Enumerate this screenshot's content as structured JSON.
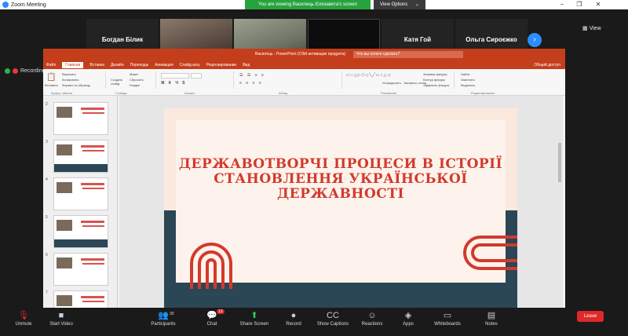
{
  "titlebar": {
    "app_name": "Zoom Meeting",
    "minimize": "−",
    "restore": "❐",
    "close": "✕"
  },
  "banner": {
    "viewing": "You are viewing Василець Єлизавета's screen",
    "view_options": "View Options"
  },
  "gallery": {
    "participants": [
      {
        "big": "Богдан Білик",
        "name": "Богдан Білик",
        "muted": true,
        "kind": "name"
      },
      {
        "big": "",
        "name": "Мірошниченко Вален...",
        "muted": true,
        "kind": "video1"
      },
      {
        "big": "",
        "name": "Оксана Васюк",
        "muted": false,
        "kind": "video2"
      },
      {
        "big": "",
        "name": "Василець Єлизавета",
        "muted": false,
        "kind": "dark"
      },
      {
        "big": "Катя Гой",
        "name": "Катя Гой",
        "muted": true,
        "kind": "name"
      },
      {
        "big": "Ольга Сироєжко",
        "name": "Ольга Сироєжко",
        "muted": true,
        "kind": "name"
      }
    ],
    "view_label": "View"
  },
  "recording": {
    "label": "Recording"
  },
  "powerpoint": {
    "window_title": "Василець - PowerPoint (Сбій активации продукта)",
    "search_placeholder": "Что вы хотите сделать?",
    "tabs": [
      "Файл",
      "Главная",
      "Вставка",
      "Дизайн",
      "Переходы",
      "Анимация",
      "Слайд-шоу",
      "Рецензирование",
      "Вид"
    ],
    "active_tab": "Главная",
    "share": "Общий доступ",
    "ribbon_groups": [
      "Буфер обмена",
      "Слайды",
      "Шрифт",
      "Абзац",
      "Рисование",
      "Редактирование"
    ],
    "ribbon_buttons": {
      "paste": "Вставить",
      "cut": "Вырезать",
      "copy": "Копировать",
      "format_painter": "Формат по образцу",
      "new_slide": "Создать слайд",
      "layout": "Макет",
      "reset": "Сбросить",
      "section": "Раздел",
      "arrange": "Упорядочить",
      "quick_styles": "Экспресс-стили",
      "shape_fill": "Заливка фигуры",
      "shape_outline": "Контур фигуры",
      "shape_effects": "Эффекты фигуры",
      "find": "Найти",
      "replace": "Заменить",
      "select": "Выделить"
    },
    "thumb_numbers": [
      "2",
      "3",
      "4",
      "5",
      "6",
      "7"
    ],
    "slide_title": "ДЕРЖАВОТВОРЧІ ПРОЦЕСИ В ІСТОРІЇ СТАНОВЛЕННЯ УКРАЇНСЬКОЇ ДЕРЖАВНОСТІ"
  },
  "toolbar": {
    "unmute": "Unmute",
    "start_video": "Start Video",
    "participants": "Participants",
    "participants_count": "30",
    "chat": "Chat",
    "chat_badge": "13",
    "share_screen": "Share Screen",
    "record": "Record",
    "show_captions": "Show Captions",
    "reactions": "Reactions",
    "apps": "Apps",
    "whiteboards": "Whiteboards",
    "notes": "Notes",
    "leave": "Leave"
  },
  "colors": {
    "zoom_blue": "#2d8cff",
    "ppt_red": "#c43e1c",
    "slide_title": "#d23a2c",
    "slide_navy": "#2b4654",
    "leave_red": "#e02828",
    "share_green": "#2bd05a"
  }
}
